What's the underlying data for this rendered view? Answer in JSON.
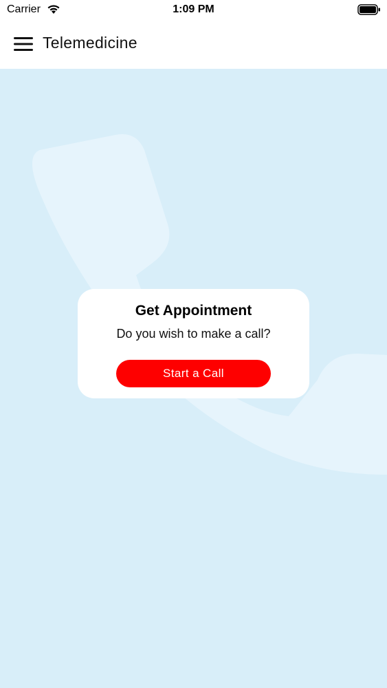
{
  "status_bar": {
    "carrier": "Carrier",
    "time": "1:09 PM",
    "wifi_icon": "wifi-icon",
    "battery_icon": "battery-icon"
  },
  "header": {
    "menu_icon": "hamburger-menu-icon",
    "title": "Telemedicine"
  },
  "card": {
    "title": "Get Appointment",
    "text": "Do you wish to make a call?",
    "button_label": "Start a Call"
  },
  "colors": {
    "background": "#d8eef9",
    "accent": "#fe0000",
    "card": "#ffffff"
  }
}
